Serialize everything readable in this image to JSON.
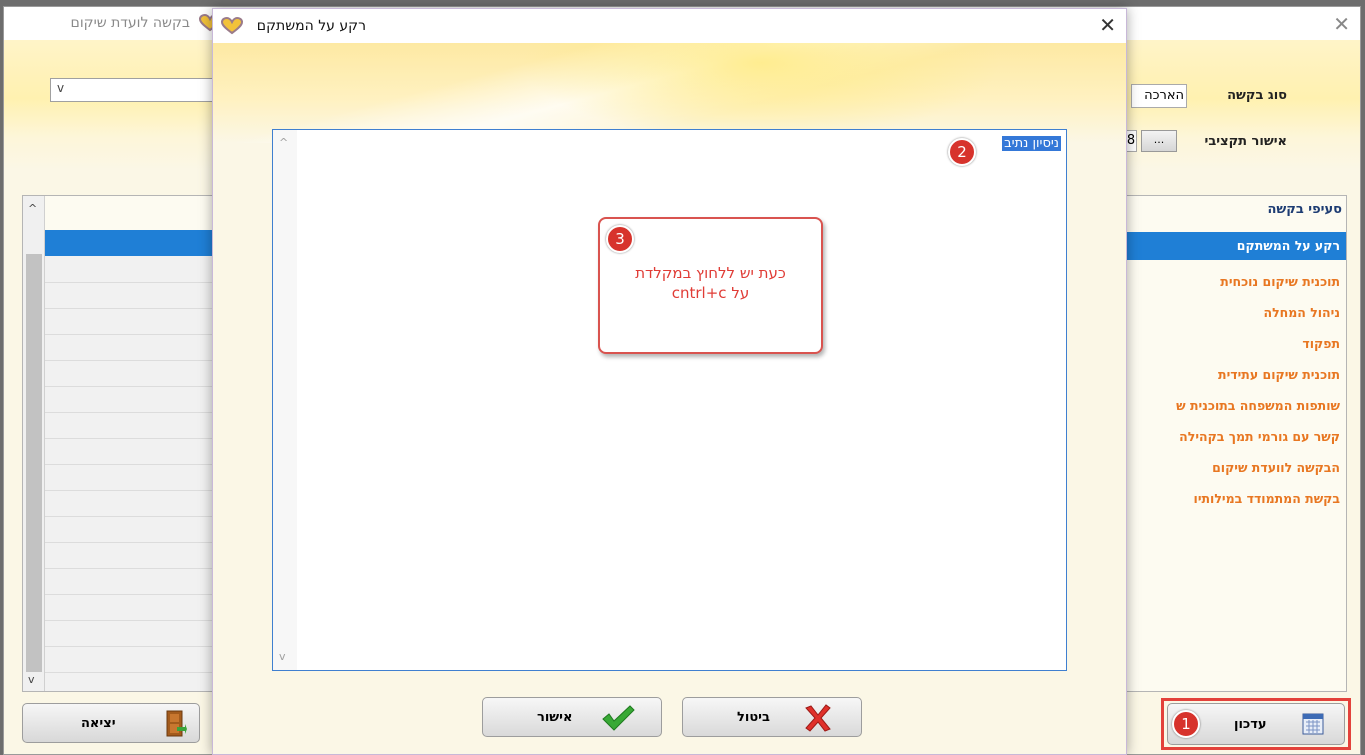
{
  "background_window": {
    "title": "בקשה לועדת שיקום",
    "request_type_label": "סוג בקשה",
    "request_type_value": "הארכה",
    "budget_approval_label": "אישור תקציבי",
    "budget_button_label": "...",
    "budget_value": "8",
    "sections_header": "סעיפי בקשה",
    "sections": [
      "רקע על המשתקם",
      "תוכנית שיקום נוכחית",
      "ניהול המחלה",
      "תפקוד",
      "תוכנית שיקום עתידית",
      "שותפות המשפחה בתוכנית ש",
      "קשר עם גורמי תמך בקהילה",
      "הבקשה לוועדת שיקום",
      "בקשת המתמודד במילותיו"
    ],
    "selected_section_index": 0,
    "exit_label": "יציאה",
    "update_label": "עדכון",
    "scroll_up_glyph": "^",
    "scroll_down_glyph": "v",
    "close_glyph": "✕",
    "dropdown_glyph": "v"
  },
  "modal": {
    "title": "רקע על המשתקם",
    "close_glyph": "✕",
    "text_content": "ניסיון נתיב",
    "ok_label": "אישור",
    "cancel_label": "ביטול",
    "scroll_up_glyph": "^",
    "scroll_down_glyph": "v"
  },
  "annotations": {
    "badge_1": "1",
    "badge_2": "2",
    "badge_3": "3",
    "callout_line1": "כעת יש ללחוץ במקלדת",
    "callout_line2": "על cntrl+c"
  },
  "colors": {
    "accent_blue": "#1f7fd6",
    "section_orange": "#e87722",
    "annotation_red": "#d7332c"
  }
}
